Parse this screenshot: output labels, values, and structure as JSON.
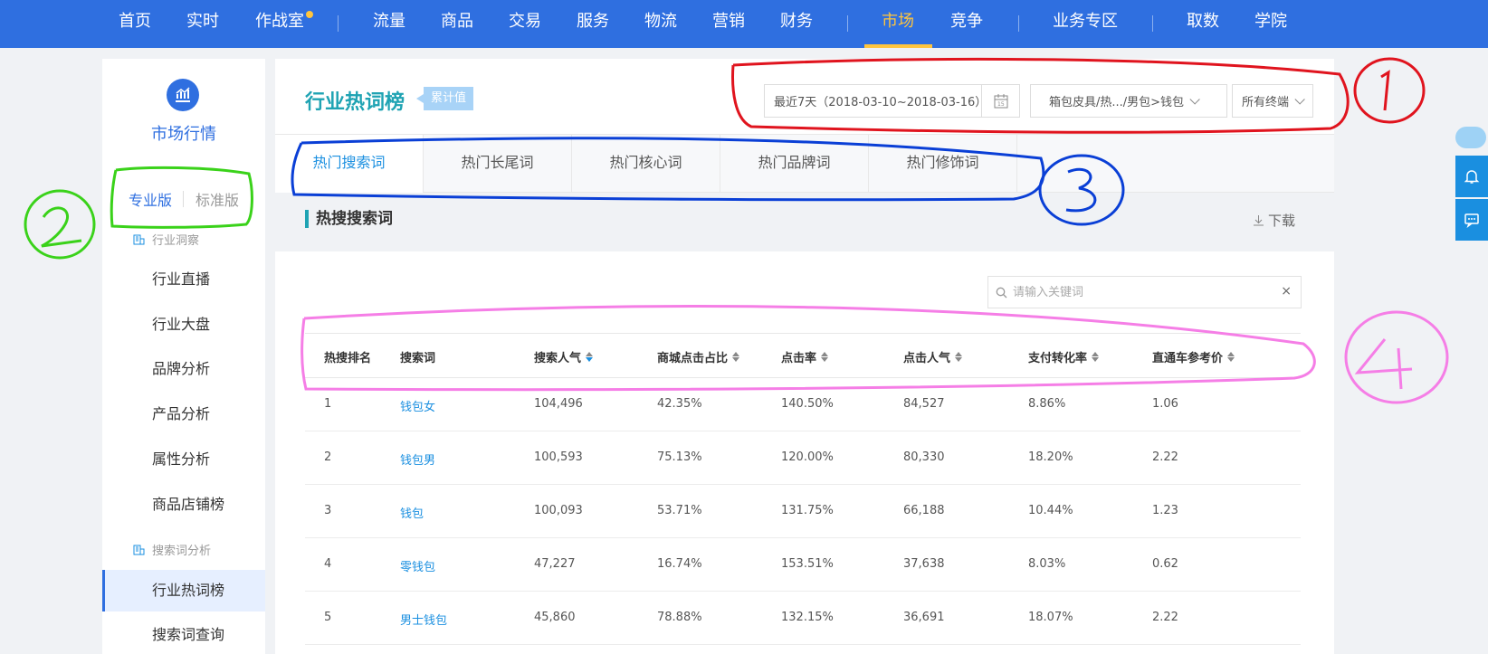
{
  "colors": {
    "nav_bg": "#2f6fe0",
    "nav_active": "#ffc53d",
    "accent": "#1a8fe0",
    "title": "#1fa3b3",
    "ann_red": "#e0141e",
    "ann_blue": "#0a3fd6",
    "ann_green": "#3ad21a",
    "ann_pink": "#f57ee6"
  },
  "nav": {
    "items": [
      "首页",
      "实时",
      "作战室",
      "流量",
      "商品",
      "交易",
      "服务",
      "物流",
      "营销",
      "财务",
      "市场",
      "竞争",
      "业务专区",
      "取数",
      "学院"
    ],
    "active": "市场"
  },
  "sidebar": {
    "logo_icon": "chart-icon",
    "title": "市场行情",
    "versions": {
      "pro": "专业版",
      "std": "标准版"
    },
    "group1": "行业洞察",
    "group1_items": [
      "行业直播",
      "行业大盘",
      "品牌分析",
      "产品分析",
      "属性分析",
      "商品店铺榜"
    ],
    "group2": "搜索词分析",
    "group2_items": [
      "行业热词榜",
      "搜索词查询"
    ],
    "active": "行业热词榜"
  },
  "header": {
    "title": "行业热词榜",
    "tag": "累计值",
    "date_range": "最近7天（2018-03-10~2018-03-16）",
    "category": "箱包皮具/热.../男包>钱包",
    "terminal": "所有终端"
  },
  "tabs": [
    "热门搜索词",
    "热门长尾词",
    "热门核心词",
    "热门品牌词",
    "热门修饰词"
  ],
  "active_tab": "热门搜索词",
  "section": {
    "title": "热搜搜索词",
    "download": "下载"
  },
  "search": {
    "placeholder": "请输入关键词"
  },
  "table": {
    "headers": [
      "热搜排名",
      "搜索词",
      "搜索人气",
      "商城点击占比",
      "点击率",
      "点击人气",
      "支付转化率",
      "直通车参考价"
    ],
    "rows": [
      [
        "1",
        "钱包女",
        "104,496",
        "42.35%",
        "140.50%",
        "84,527",
        "8.86%",
        "1.06"
      ],
      [
        "2",
        "钱包男",
        "100,593",
        "75.13%",
        "120.00%",
        "80,330",
        "18.20%",
        "2.22"
      ],
      [
        "3",
        "钱包",
        "100,093",
        "53.71%",
        "131.75%",
        "66,188",
        "10.44%",
        "1.23"
      ],
      [
        "4",
        "零钱包",
        "47,227",
        "16.74%",
        "153.51%",
        "37,638",
        "8.03%",
        "0.62"
      ],
      [
        "5",
        "男士钱包",
        "45,860",
        "78.88%",
        "132.15%",
        "36,691",
        "18.07%",
        "2.22"
      ]
    ]
  },
  "right_rail": {
    "icons": [
      "bell-icon",
      "chat-icon"
    ]
  }
}
